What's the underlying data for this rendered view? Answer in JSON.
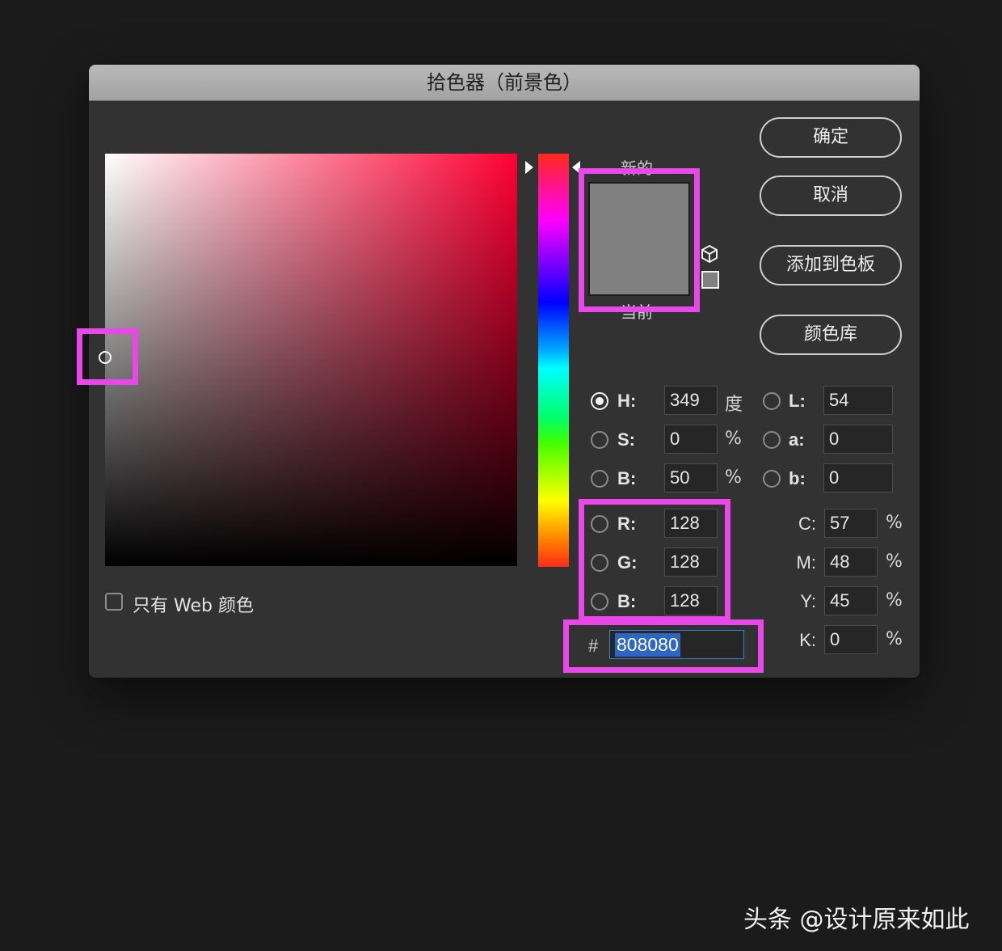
{
  "dialog": {
    "title": "拾色器（前景色）",
    "new_label": "新的",
    "current_label": "当前",
    "new_color": "#808080",
    "current_color": "#808080",
    "gamut_icon": "cube-icon",
    "buttons": {
      "ok": "确定",
      "cancel": "取消",
      "add_to_swatches": "添加到色板",
      "color_libraries": "颜色库"
    },
    "web_only_label": "只有 Web 颜色",
    "web_only_checked": false
  },
  "values": {
    "H": {
      "label": "H:",
      "value": "349",
      "unit": "度",
      "selected": true
    },
    "S": {
      "label": "S:",
      "value": "0",
      "unit": "%"
    },
    "Bv": {
      "label": "B:",
      "value": "50",
      "unit": "%"
    },
    "R": {
      "label": "R:",
      "value": "128"
    },
    "G": {
      "label": "G:",
      "value": "128"
    },
    "Bc": {
      "label": "B:",
      "value": "128"
    },
    "L": {
      "label": "L:",
      "value": "54"
    },
    "a": {
      "label": "a:",
      "value": "0"
    },
    "b": {
      "label": "b:",
      "value": "0"
    },
    "C": {
      "label": "C:",
      "value": "57",
      "unit": "%"
    },
    "M": {
      "label": "M:",
      "value": "48",
      "unit": "%"
    },
    "Y": {
      "label": "Y:",
      "value": "45",
      "unit": "%"
    },
    "K": {
      "label": "K:",
      "value": "0",
      "unit": "%"
    },
    "hex_prefix": "#",
    "hex": "808080"
  },
  "highlight_color": "#e948e8",
  "watermark": "头条 @设计原来如此"
}
